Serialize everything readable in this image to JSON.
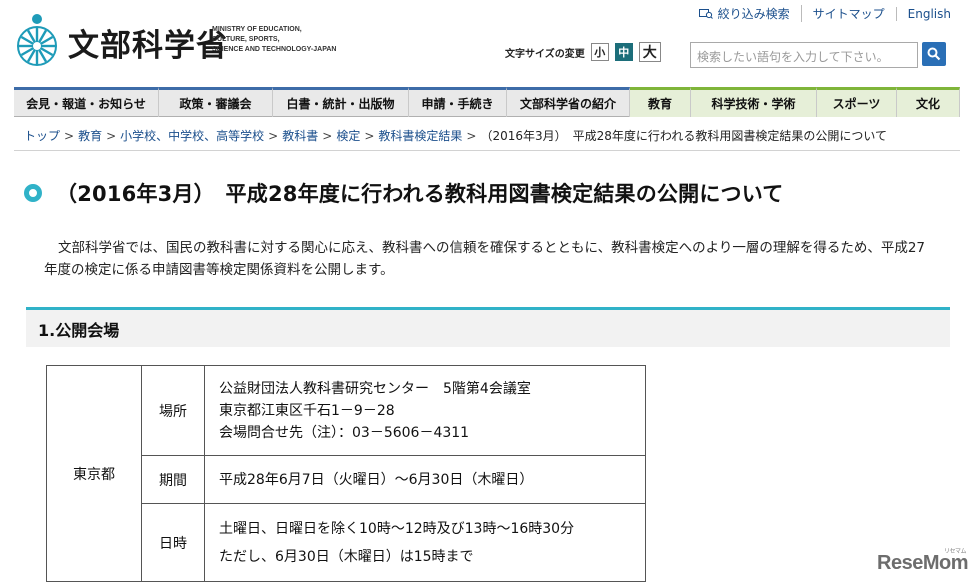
{
  "header": {
    "logo_title": "文部科学省",
    "logo_sub": [
      "MINISTRY OF EDUCATION,",
      "CULTURE, SPORTS,",
      "SCIENCE AND TECHNOLOGY-JAPAN"
    ],
    "util_links": [
      {
        "label": "絞り込み検索",
        "icon": "refine-search-icon"
      },
      {
        "label": "サイトマップ"
      },
      {
        "label": "English"
      }
    ],
    "font_size_label": "文字サイズの変更",
    "font_sizes": [
      "小",
      "中",
      "大"
    ],
    "search_placeholder": "検索したい語句を入力して下さい。"
  },
  "nav": [
    {
      "label": "会見・報道・お知らせ",
      "width": 145
    },
    {
      "label": "政策・審議会",
      "width": 114
    },
    {
      "label": "白書・統計・出版物",
      "width": 136
    },
    {
      "label": "申請・手続き",
      "width": 98
    },
    {
      "label": "文部科学省の紹介",
      "width": 123
    },
    {
      "label": "教育",
      "width": 61,
      "green": true
    },
    {
      "label": "科学技術・学術",
      "width": 126,
      "green": true
    },
    {
      "label": "スポーツ",
      "width": 80,
      "green": true
    },
    {
      "label": "文化",
      "width": 63,
      "green": true
    }
  ],
  "breadcrumb": [
    {
      "label": "トップ",
      "link": true
    },
    {
      "label": "教育",
      "link": true
    },
    {
      "label": "小学校、中学校、高等学校",
      "link": true
    },
    {
      "label": "教科書",
      "link": true
    },
    {
      "label": "検定",
      "link": true
    },
    {
      "label": "教科書検定結果",
      "link": true
    },
    {
      "label": "（2016年3月）　平成28年度に行われる教科用図書検定結果の公開について",
      "link": false
    }
  ],
  "page_title": "（2016年3月）　平成28年度に行われる教科用図書検定結果の公開について",
  "intro": "文部科学省では、国民の教科書に対する関心に応え、教科書への信頼を確保するとともに、教科書検定へのより一層の理解を得るため、平成27年度の検定に係る申請図書等検定関係資料を公開します。",
  "section_heading": "1.公開会場",
  "table": {
    "region": "東京都",
    "rows": [
      {
        "label": "場所",
        "lines": [
          "公益財団法人教科書研究センター　5階第4会議室",
          "東京都江東区千石1－9－28",
          "会場問合せ先（注）：03－5606－4311"
        ]
      },
      {
        "label": "期間",
        "lines": [
          "平成28年6月7日（火曜日）～6月30日（木曜日）"
        ]
      },
      {
        "label": "日時",
        "lines": [
          "土曜日、日曜日を除く10時～12時及び13時～16時30分",
          "ただし、6月30日（木曜日）は15時まで"
        ]
      }
    ]
  },
  "watermark": {
    "text": "ReseMom",
    "tag": "リセマム"
  },
  "colors": {
    "accent_blue": "#3d6ca8",
    "accent_green": "#7fb539",
    "teal": "#30b2c8",
    "link": "#1b4f8c"
  }
}
